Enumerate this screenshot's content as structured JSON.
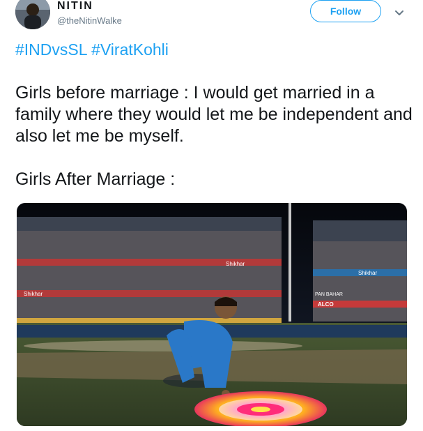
{
  "tweet": {
    "author": {
      "display_name": "NITIN",
      "handle": "@theNitinWalke"
    },
    "follow_label": "Follow",
    "hashtags": [
      "#INDvsSL",
      "#ViratKohli"
    ],
    "text_lines": [
      "Girls before marriage : I would get married in a family where they would let me be independent and also let me be myself.",
      "Girls After Marriage :"
    ]
  },
  "media": {
    "banner_texts": [
      "Shikhar",
      "Shikhar",
      "Shikhar",
      "PAN BAHAR",
      "ALCO"
    ]
  },
  "colors": {
    "accent": "#1da1f2",
    "text": "#14171a",
    "secondary": "#657786"
  }
}
